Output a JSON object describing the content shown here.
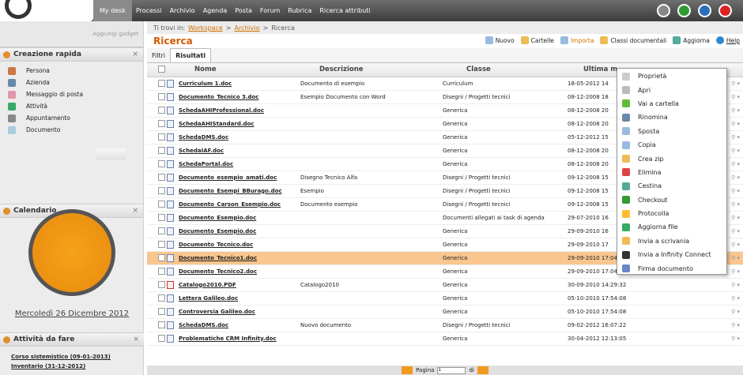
{
  "nav": {
    "items": [
      "My desk",
      "Processi",
      "Archivio",
      "Agenda",
      "Posta",
      "Forum",
      "Rubrica",
      "Ricerca attributi"
    ]
  },
  "left": {
    "add_gadget": "Aggiungi gadget",
    "quick": {
      "title": "Creazione rapida",
      "items": [
        "Persona",
        "Azienda",
        "Messaggio di posta",
        "Attività",
        "Appuntamento",
        "Documento"
      ]
    },
    "calendar": {
      "title": "Calendario",
      "date": "Mercoledì 26 Dicembre 2012"
    },
    "tasks": {
      "title": "Attività da fare",
      "items": [
        "Corso sistemistico (09-01-2013)",
        "Inventario (31-12-2012)"
      ]
    }
  },
  "breadcrumb": {
    "prefix": "Ti trovi in:",
    "workspace": "Workspace",
    "archivio": "Archivio",
    "current": "Ricerca",
    "sep": ">"
  },
  "main": {
    "title": "Ricerca",
    "tools": [
      "Nuovo",
      "Cartelle",
      "Importa",
      "Classi documentali",
      "Aggiorna",
      "Help"
    ],
    "tabs": [
      "Filtri",
      "Risultati"
    ],
    "cols": [
      "Nome",
      "Descrizione",
      "Classe",
      "Ultima m"
    ],
    "rows": [
      [
        "Curriculum 1.doc",
        "Documento di esempio",
        "Curriculum",
        "18-05-2012 14"
      ],
      [
        "Documento_Tecnico 3.doc",
        "Esempio Documento con Word",
        "Disegni / Progetti tecnici",
        "08-12-2008 18"
      ],
      [
        "SchedaAHIProfessional.doc",
        "",
        "Generica",
        "08-12-2008 20"
      ],
      [
        "SchedaAHIStandard.doc",
        "",
        "Generica",
        "08-12-2008 20"
      ],
      [
        "SchedaDMS.doc",
        "",
        "Generica",
        "05-12-2012 15"
      ],
      [
        "SchedaIAF.doc",
        "",
        "Generica",
        "08-12-2008 20"
      ],
      [
        "SchedaPortal.doc",
        "",
        "Generica",
        "08-12-2008 20"
      ],
      [
        "Documento_esempio_amati.doc",
        "Disegno Tecnico Alfa",
        "Disegni / Progetti tecnici",
        "09-12-2008 15"
      ],
      [
        "Documento_Esempi_BBurago.doc",
        "Esempio",
        "Disegni / Progetti tecnici",
        "09-12-2008 15"
      ],
      [
        "Documento_Carson_Esempio.doc",
        "Documento esempio",
        "Disegni / Progetti tecnici",
        "09-12-2008 15"
      ],
      [
        "Documento_Esempio.doc",
        "",
        "Documenti allegati ai task di agenda",
        "29-07-2010 16"
      ],
      [
        "Documento_Esempio.doc",
        "",
        "Generica",
        "29-09-2010 16"
      ],
      [
        "Documento_Tecnico.doc",
        "",
        "Generica",
        "29-09-2010 17"
      ],
      [
        "Documento_Tecnico1.doc",
        "",
        "Generica",
        "29-09-2010 17:04:32"
      ],
      [
        "Documento_Tecnico2.doc",
        "",
        "Generica",
        "29-09-2010 17:04:32"
      ],
      [
        "Catalogo2010.PDF",
        "Catalogo2010",
        "Generica",
        "30-09-2010 14:29:32"
      ],
      [
        "Lettera Galileo.doc",
        "",
        "Generica",
        "05-10-2010 17:54:08"
      ],
      [
        "Controversia Galileo.doc",
        "",
        "Generica",
        "05-10-2010 17:54:08"
      ],
      [
        "SchedaDMS.doc",
        "Nuovo documento",
        "Disegni / Progetti tecnici",
        "09-02-2012 16:07:22"
      ],
      [
        "Problematiche CRM Infinity.doc",
        "",
        "Generica",
        "30-04-2012 12:13:05"
      ]
    ]
  },
  "context_menu": [
    "Proprietà",
    "Apri",
    "Vai a cartella",
    "Rinomina",
    "Sposta",
    "Copia",
    "Crea zip",
    "Elimina",
    "Cestina",
    "Checkout",
    "Protocolla",
    "Aggiorna file",
    "Invia a scrivania",
    "Invia a Infinity Connect",
    "Firma documento"
  ],
  "footer": {
    "page_label": "Pagina",
    "page": "1",
    "of": "di"
  }
}
